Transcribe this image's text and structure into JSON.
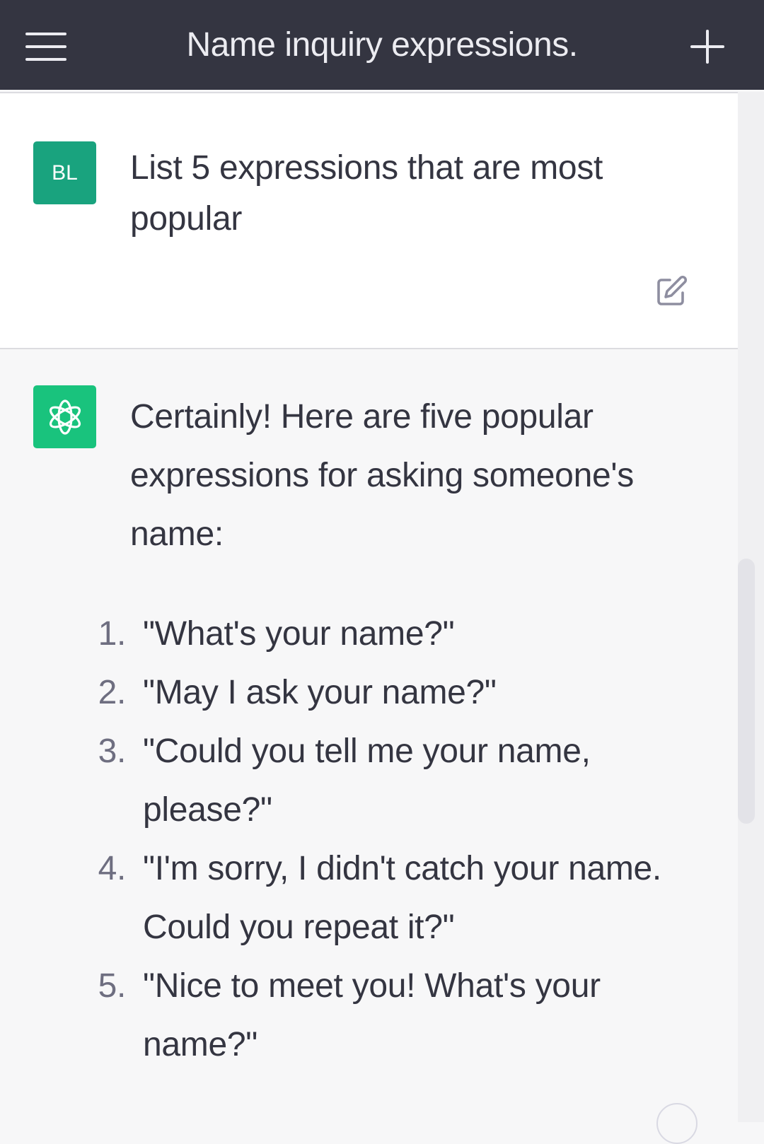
{
  "header": {
    "title": "Name inquiry expressions.",
    "menu_icon": "hamburger-menu-icon",
    "new_chat_icon": "plus-icon"
  },
  "user_message": {
    "avatar_initials": "BL",
    "text": "List 5 expressions that are most popular",
    "edit_icon": "edit-icon",
    "avatar_color": "#19a37e"
  },
  "assistant_message": {
    "avatar_icon": "openai-logo-icon",
    "avatar_color": "#19c37d",
    "intro": "Certainly! Here are five popular expressions for asking someone's name:",
    "items": [
      {
        "num": "1.",
        "text": "\"What's your name?\""
      },
      {
        "num": "2.",
        "text": "\"May I ask your name?\""
      },
      {
        "num": "3.",
        "text": "\"Could you tell me your name, please?\""
      },
      {
        "num": "4.",
        "text": "\"I'm sorry, I didn't catch your name. Could you repeat it?\""
      },
      {
        "num": "5.",
        "text": "\"Nice to meet you! What's your name?\""
      }
    ]
  },
  "colors": {
    "header_bg": "#343541",
    "body_bg": "#f7f7f8",
    "text": "#343541"
  }
}
